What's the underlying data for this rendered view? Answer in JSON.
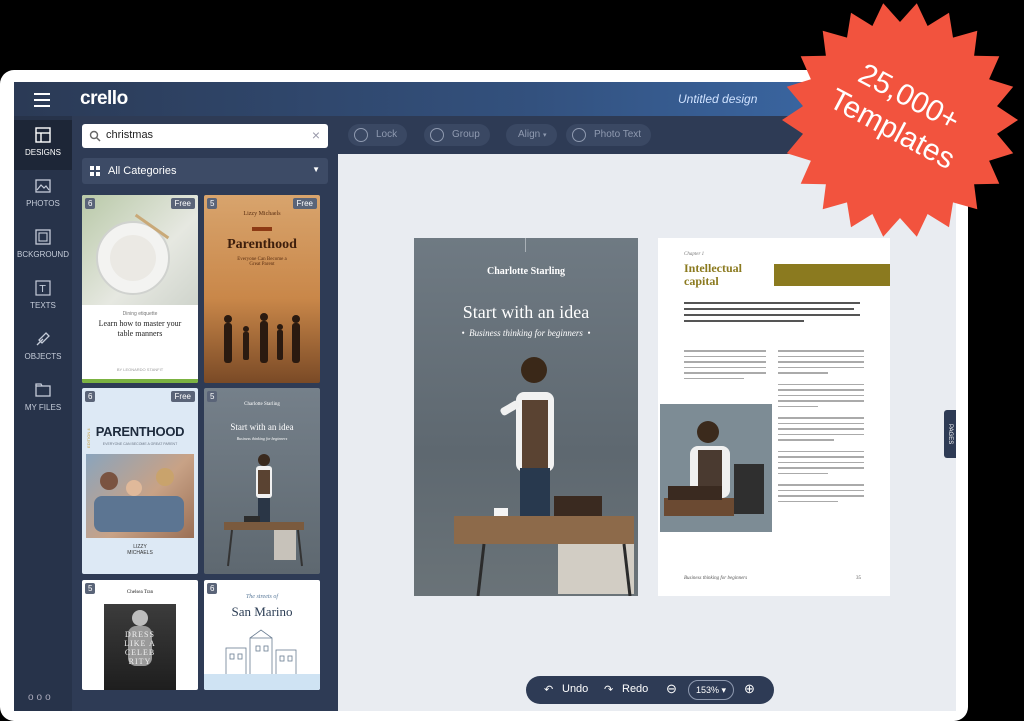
{
  "app": {
    "logo": "crello",
    "document_title": "Untitled design"
  },
  "nav": [
    {
      "label": "DESIGNS"
    },
    {
      "label": "PHOTOS"
    },
    {
      "label": "BCKGROUND"
    },
    {
      "label": "TEXTS"
    },
    {
      "label": "OBJECTS"
    },
    {
      "label": "MY FILES"
    }
  ],
  "nav_more": "ooo",
  "search": {
    "value": "christmas",
    "clear": "×"
  },
  "category": {
    "label": "All Categories"
  },
  "templates": [
    {
      "count": "6",
      "free": "Free",
      "subtitle": "Dining etiquette",
      "title": "Learn how to master your table manners",
      "author": "BY LEONARDO STANFIT"
    },
    {
      "count": "5",
      "free": "Free",
      "author": "Lizzy Michaels",
      "title": "Parenthood",
      "subtitle": "Everyone Can Become a Great Parent"
    },
    {
      "count": "6",
      "free": "Free",
      "title": "PARENTHOOD",
      "subtitle": "EVERYONE CAN BECOME A GREAT PARENT",
      "author": "LIZZY\nMICHAELS",
      "edition": "EDITION 4"
    },
    {
      "count": "5",
      "author": "Charlotte Starling",
      "title": "Start with an idea",
      "subtitle": "Business thinking for beginners"
    },
    {
      "count": "5",
      "author": "Chelsea Tran",
      "title": "DRESS LIKE A CELEB RITY"
    },
    {
      "count": "6",
      "subtitle": "The streets of",
      "title": "San Marino"
    }
  ],
  "toolbar": [
    {
      "label": "Lock"
    },
    {
      "label": "Group"
    },
    {
      "label": "Align"
    },
    {
      "label": "Photo Text"
    }
  ],
  "left_page": {
    "author": "Charlotte Starling",
    "title": "Start with an idea",
    "subtitle": "Business thinking for beginners"
  },
  "right_page": {
    "chapter": "Chapter 1",
    "title": "Intellectual capital",
    "footer_left": "Business thinking for beginners",
    "footer_page": "35"
  },
  "pages_tab": "PAGES",
  "bottombar": {
    "undo": "Undo",
    "redo": "Redo",
    "zoom": "153%"
  },
  "promo": {
    "line1": "25,000+",
    "line2": "Templates"
  },
  "colors": {
    "promo": "#f2533e",
    "accent_gold": "#8b7a1f",
    "panel": "#2e3b55"
  }
}
